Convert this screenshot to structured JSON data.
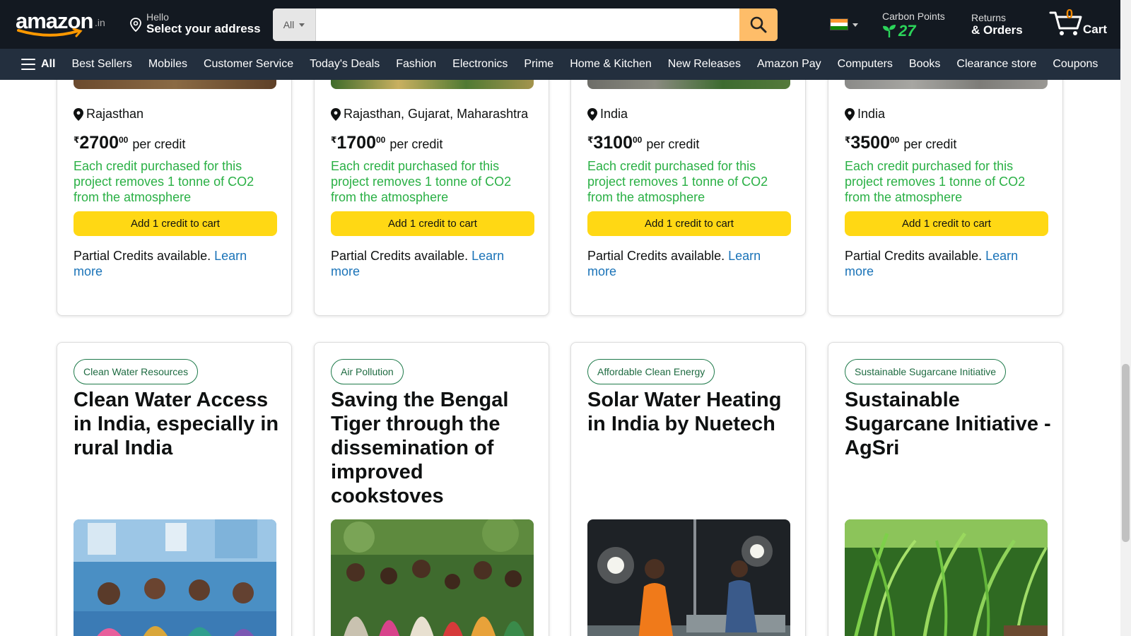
{
  "header": {
    "logo_text": "amazon",
    "logo_tld": ".in",
    "address_greeting": "Hello",
    "address_label": "Select your address",
    "search_category": "All",
    "search_placeholder": "",
    "carbon_label": "Carbon Points",
    "carbon_value": "27",
    "returns_line1": "Returns",
    "returns_line2": "& Orders",
    "cart_count": "0",
    "cart_label": "Cart"
  },
  "nav": {
    "all_label": "All",
    "links": [
      "Best Sellers",
      "Mobiles",
      "Customer Service",
      "Today's Deals",
      "Fashion",
      "Electronics",
      "Prime",
      "Home & Kitchen",
      "New Releases",
      "Amazon Pay",
      "Computers",
      "Books",
      "Clearance store",
      "Coupons"
    ]
  },
  "top_cards": [
    {
      "location": "Rajasthan",
      "currency": "₹",
      "price_whole": "2700",
      "price_fraction": "00",
      "per": "per credit",
      "description": "Each credit purchased for this project removes 1 tonne of CO2 from the atmosphere",
      "button": "Add 1 credit to cart",
      "partial_text": "Partial Credits available.",
      "learn_more": "Learn more"
    },
    {
      "location": "Rajasthan, Gujarat, Maharashtra",
      "currency": "₹",
      "price_whole": "1700",
      "price_fraction": "00",
      "per": "per credit",
      "description": "Each credit purchased for this project removes 1 tonne of CO2 from the atmosphere",
      "button": "Add 1 credit to cart",
      "partial_text": "Partial Credits available.",
      "learn_more": "Learn more"
    },
    {
      "location": "India",
      "currency": "₹",
      "price_whole": "3100",
      "price_fraction": "00",
      "per": "per credit",
      "description": "Each credit purchased for this project removes 1 tonne of CO2 from the atmosphere",
      "button": "Add 1 credit to cart",
      "partial_text": "Partial Credits available.",
      "learn_more": "Learn more"
    },
    {
      "location": "India",
      "currency": "₹",
      "price_whole": "3500",
      "price_fraction": "00",
      "per": "per credit",
      "description": "Each credit purchased for this project removes 1 tonne of CO2 from the atmosphere",
      "button": "Add 1 credit to cart",
      "partial_text": "Partial Credits available.",
      "learn_more": "Learn more"
    }
  ],
  "bottom_cards": [
    {
      "tag": "Clean Water Resources",
      "title": "Clean Water Access in India, especially in rural India"
    },
    {
      "tag": "Air Pollution",
      "title": "Saving the Bengal Tiger through the dissemination of improved cookstoves"
    },
    {
      "tag": "Affordable Clean Energy",
      "title": "Solar Water Heating in India by Nuetech"
    },
    {
      "tag": "Sustainable Sugarcane Initiative",
      "title": "Sustainable Sugarcane Initiative - AgSri"
    }
  ],
  "colors": {
    "header_bg": "#131921",
    "nav_bg": "#232f3e",
    "search_button": "#febd69",
    "add_button": "#ffd814",
    "description_green": "#2ab045",
    "link_blue": "#1a73b8",
    "carbon_green": "#2bd45a",
    "cart_count": "#f08804"
  }
}
